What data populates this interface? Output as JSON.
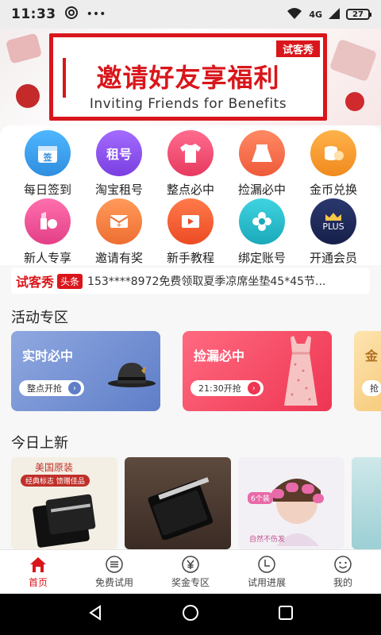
{
  "status_bar": {
    "time": "11:33",
    "dots": "•••",
    "network": "4G",
    "battery": "27"
  },
  "banner": {
    "ribbon": "试客秀",
    "title": "邀请好友享福利",
    "subtitle": "Inviting Friends for Benefits"
  },
  "grid": {
    "items": [
      {
        "label": "每日签到",
        "icon": "calendar-icon",
        "glyph": "签",
        "color": "#3aa0f0"
      },
      {
        "label": "淘宝租号",
        "icon": "rent-icon",
        "glyph": "租号",
        "color": "#8a4de8"
      },
      {
        "label": "整点必中",
        "icon": "tshirt-icon",
        "glyph": "",
        "color": "#ec3f6a"
      },
      {
        "label": "捡漏必中",
        "icon": "skirt-icon",
        "glyph": "",
        "color": "#f06a4a"
      },
      {
        "label": "金币兑换",
        "icon": "coins-icon",
        "glyph": "",
        "color": "#f59a2c"
      },
      {
        "label": "新人专享",
        "icon": "lipstick-icon",
        "glyph": "",
        "color": "#e94f92"
      },
      {
        "label": "邀请有奖",
        "icon": "envelope-icon",
        "glyph": "",
        "color": "#f07a3a"
      },
      {
        "label": "新手教程",
        "icon": "video-icon",
        "glyph": "",
        "color": "#f0562e"
      },
      {
        "label": "绑定账号",
        "icon": "flower-icon",
        "glyph": "",
        "color": "#25b9c9"
      },
      {
        "label": "开通会员",
        "icon": "crown-icon",
        "glyph": "PLUS",
        "color": "#1f2a5a"
      }
    ]
  },
  "ticker": {
    "brand": "试客秀",
    "tag": "头条",
    "text": "153****8972免费领取夏季凉席坐垫45*45节..."
  },
  "sections": {
    "activity": "活动专区",
    "new_today": "今日上新"
  },
  "activity_cards": [
    {
      "title": "实时必中",
      "button": "整点开抢",
      "color": "#6f8fd0",
      "accent": "#4b6fc0"
    },
    {
      "title": "捡漏必中",
      "button": "21:30开抢",
      "color": "#f0506a",
      "accent": "#e8324a"
    },
    {
      "title": "金",
      "button": "抢",
      "color": "#f5d79a",
      "accent": "#e0a64a"
    }
  ],
  "products": [
    {
      "label": "美国原装",
      "sub": "经典标志 馈赠佳品"
    },
    {
      "label": "",
      "sub": ""
    },
    {
      "label": "6个装",
      "sub": "自然不伤发"
    },
    {
      "label": "",
      "sub": ""
    }
  ],
  "tabbar": {
    "tabs": [
      {
        "label": "首页",
        "icon": "home-icon",
        "active": true
      },
      {
        "label": "免费试用",
        "icon": "list-icon",
        "active": false
      },
      {
        "label": "奖金专区",
        "icon": "yen-icon",
        "active": false
      },
      {
        "label": "试用进展",
        "icon": "clock-icon",
        "active": false
      },
      {
        "label": "我的",
        "icon": "smile-icon",
        "active": false
      }
    ]
  }
}
